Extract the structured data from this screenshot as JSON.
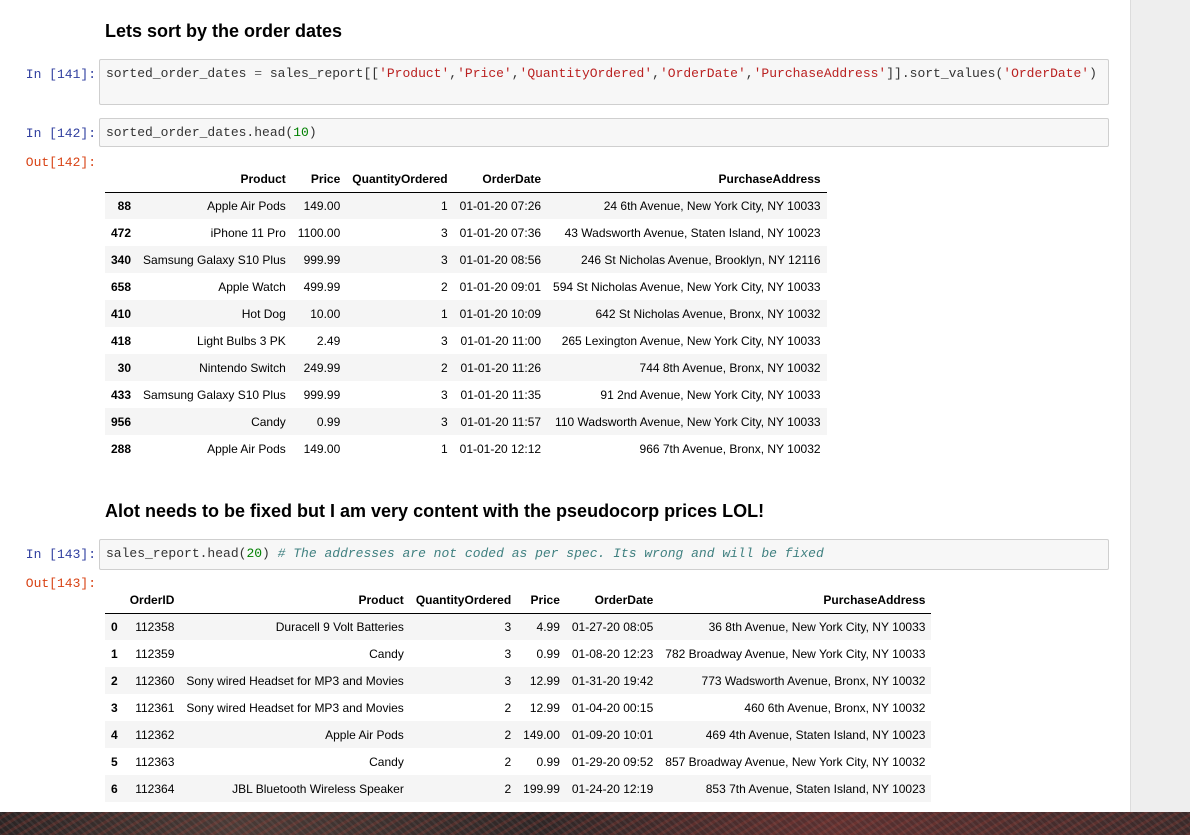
{
  "md1": "Lets sort by the order dates",
  "cells": {
    "c141": {
      "prompt": "In [141]:",
      "code": [
        {
          "t": "sorted_order_dates ",
          "k": ""
        },
        {
          "t": "=",
          "k": "o"
        },
        {
          "t": " sales_report[[",
          "k": ""
        },
        {
          "t": "'Product'",
          "k": "s"
        },
        {
          "t": ",",
          "k": ""
        },
        {
          "t": "'Price'",
          "k": "s"
        },
        {
          "t": ",",
          "k": ""
        },
        {
          "t": "'QuantityOrdered'",
          "k": "s"
        },
        {
          "t": ",",
          "k": ""
        },
        {
          "t": "'OrderDate'",
          "k": "s"
        },
        {
          "t": ",",
          "k": ""
        },
        {
          "t": "'PurchaseAddress'",
          "k": "s"
        },
        {
          "t": "]].sort_values(",
          "k": ""
        },
        {
          "t": "'OrderDate'",
          "k": "s"
        },
        {
          "t": ")",
          "k": ""
        }
      ]
    },
    "c142": {
      "prompt": "In [142]:",
      "code": [
        {
          "t": "sorted_order_dates.head(",
          "k": ""
        },
        {
          "t": "10",
          "k": "n"
        },
        {
          "t": ")",
          "k": ""
        }
      ],
      "out_prompt": "Out[142]:"
    },
    "c143": {
      "prompt": "In [143]:",
      "code": [
        {
          "t": "sales_report.head(",
          "k": ""
        },
        {
          "t": "20",
          "k": "n"
        },
        {
          "t": ") ",
          "k": ""
        },
        {
          "t": "# The addresses are not coded as per spec. Its wrong and will be fixed",
          "k": "c"
        }
      ],
      "out_prompt": "Out[143]:"
    }
  },
  "md2": "Alot needs to be fixed but I am very content with the pseudocorp prices LOL!",
  "table1": {
    "columns": [
      "",
      "Product",
      "Price",
      "QuantityOrdered",
      "OrderDate",
      "PurchaseAddress"
    ],
    "rows": [
      [
        "88",
        "Apple Air Pods",
        "149.00",
        "1",
        "01-01-20 07:26",
        "24 6th Avenue, New York City, NY 10033"
      ],
      [
        "472",
        "iPhone 11 Pro",
        "1100.00",
        "3",
        "01-01-20 07:36",
        "43 Wadsworth Avenue, Staten Island, NY 10023"
      ],
      [
        "340",
        "Samsung Galaxy S10 Plus",
        "999.99",
        "3",
        "01-01-20 08:56",
        "246 St Nicholas Avenue, Brooklyn, NY 12116"
      ],
      [
        "658",
        "Apple Watch",
        "499.99",
        "2",
        "01-01-20 09:01",
        "594 St Nicholas Avenue, New York City, NY 10033"
      ],
      [
        "410",
        "Hot Dog",
        "10.00",
        "1",
        "01-01-20 10:09",
        "642 St Nicholas Avenue, Bronx, NY 10032"
      ],
      [
        "418",
        "Light Bulbs 3 PK",
        "2.49",
        "3",
        "01-01-20 11:00",
        "265 Lexington Avenue, New York City, NY 10033"
      ],
      [
        "30",
        "Nintendo Switch",
        "249.99",
        "2",
        "01-01-20 11:26",
        "744 8th Avenue, Bronx, NY 10032"
      ],
      [
        "433",
        "Samsung Galaxy S10 Plus",
        "999.99",
        "3",
        "01-01-20 11:35",
        "91 2nd Avenue, New York City, NY 10033"
      ],
      [
        "956",
        "Candy",
        "0.99",
        "3",
        "01-01-20 11:57",
        "110 Wadsworth Avenue, New York City, NY 10033"
      ],
      [
        "288",
        "Apple Air Pods",
        "149.00",
        "1",
        "01-01-20 12:12",
        "966 7th Avenue, Bronx, NY 10032"
      ]
    ]
  },
  "table2": {
    "columns": [
      "",
      "OrderID",
      "Product",
      "QuantityOrdered",
      "Price",
      "OrderDate",
      "PurchaseAddress"
    ],
    "rows": [
      [
        "0",
        "112358",
        "Duracell 9 Volt Batteries",
        "3",
        "4.99",
        "01-27-20 08:05",
        "36 8th Avenue, New York City, NY 10033"
      ],
      [
        "1",
        "112359",
        "Candy",
        "3",
        "0.99",
        "01-08-20 12:23",
        "782 Broadway Avenue, New York City, NY 10033"
      ],
      [
        "2",
        "112360",
        "Sony wired Headset for MP3 and Movies",
        "3",
        "12.99",
        "01-31-20 19:42",
        "773 Wadsworth Avenue, Bronx, NY 10032"
      ],
      [
        "3",
        "112361",
        "Sony wired Headset for MP3 and Movies",
        "2",
        "12.99",
        "01-04-20 00:15",
        "460 6th Avenue, Bronx, NY 10032"
      ],
      [
        "4",
        "112362",
        "Apple Air Pods",
        "2",
        "149.00",
        "01-09-20 10:01",
        "469 4th Avenue, Staten Island, NY 10023"
      ],
      [
        "5",
        "112363",
        "Candy",
        "2",
        "0.99",
        "01-29-20 09:52",
        "857 Broadway Avenue, New York City, NY 10032"
      ],
      [
        "6",
        "112364",
        "JBL Bluetooth Wireless Speaker",
        "2",
        "199.99",
        "01-24-20 12:19",
        "853 7th Avenue, Staten Island, NY 10023"
      ]
    ]
  }
}
